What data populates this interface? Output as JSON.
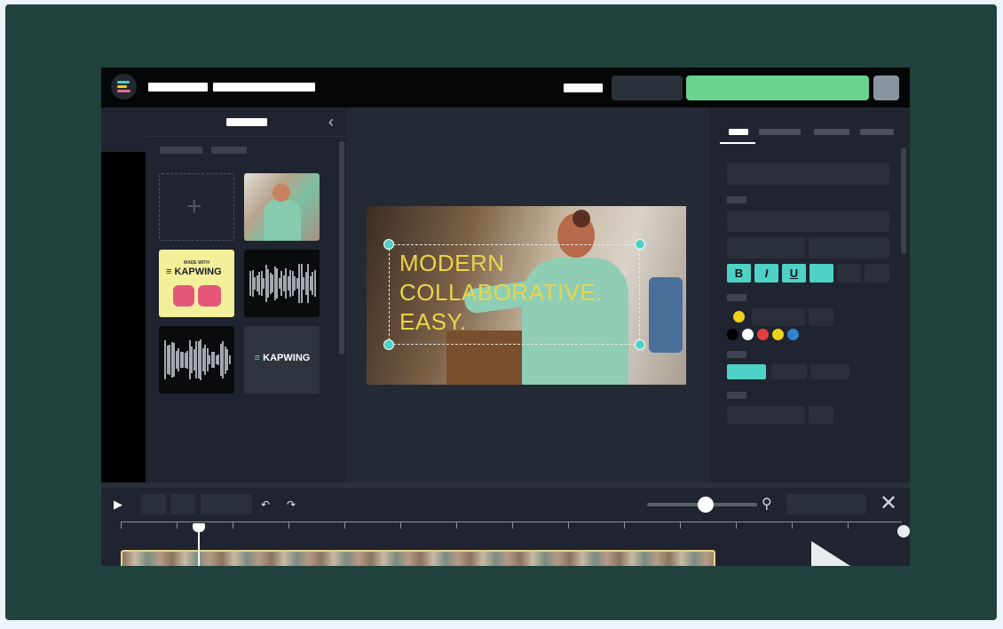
{
  "app": {
    "name": "Kapwing"
  },
  "library": {
    "tiles": [
      {
        "name": "upload",
        "label": "+"
      },
      {
        "name": "photo"
      },
      {
        "name": "podcast",
        "small": "MADE WITH",
        "brand": "KAPWING"
      },
      {
        "name": "audio-wave-1"
      },
      {
        "name": "audio-wave-2"
      },
      {
        "name": "brand-logo",
        "brand": "KAPWING"
      }
    ]
  },
  "canvas": {
    "overlay_text": [
      "MODERN",
      "COLLABORATIVE.",
      "EASY."
    ]
  },
  "format": {
    "bold": "B",
    "italic": "I",
    "underline": "U"
  },
  "colors": {
    "selected": "#ecd21c",
    "palette": [
      "#000000",
      "#ffffff",
      "#e53e3e",
      "#ecd21c",
      "#3182ce"
    ],
    "accent": "#4fd1c5",
    "brand_green": "#68d391",
    "frame": "#21423c"
  },
  "icons": {
    "collapse": "chevron-left-icon",
    "play": "play-icon",
    "undo": "undo-icon",
    "redo": "redo-icon",
    "zoom": "magnifier-icon",
    "close": "close-icon"
  }
}
